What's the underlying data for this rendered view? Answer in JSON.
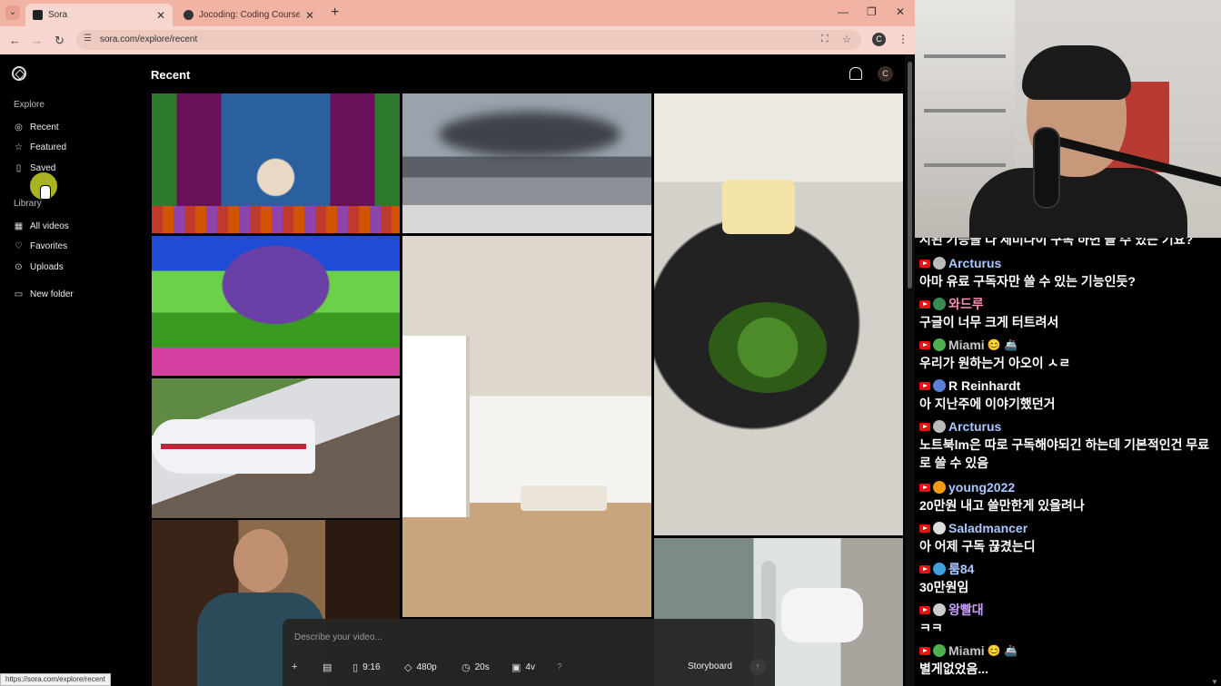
{
  "browser": {
    "tabs": [
      {
        "title": "Sora",
        "active": true
      },
      {
        "title": "Jocoding: Coding Courses & A",
        "active": false
      }
    ],
    "url": "sora.com/explore/recent",
    "profile_initial": "C",
    "status_url": "https://sora.com/explore/recent"
  },
  "sora": {
    "sidebar": {
      "explore_title": "Explore",
      "explore_items": [
        {
          "label": "Recent",
          "icon": "compass-icon",
          "active": true
        },
        {
          "label": "Featured",
          "icon": "star-icon"
        },
        {
          "label": "Saved",
          "icon": "bookmark-icon"
        }
      ],
      "library_title": "Library",
      "library_items": [
        {
          "label": "All videos",
          "icon": "video-grid-icon"
        },
        {
          "label": "Favorites",
          "icon": "heart-icon"
        },
        {
          "label": "Uploads",
          "icon": "upload-icon"
        }
      ],
      "new_folder": "New folder"
    },
    "header": {
      "title": "Recent",
      "avatar_initial": "C"
    },
    "composer": {
      "placeholder": "Describe your video...",
      "aspect": "9:16",
      "resolution": "480p",
      "duration": "20s",
      "variations": "4v",
      "help": "?",
      "storyboard": "Storyboard"
    }
  },
  "chat": {
    "partial_top": "시된 기능을 다 제미나이 구독 하면 쓸 수 있는 기요?",
    "messages": [
      {
        "name": "Arcturus",
        "name_color": "#a9c8ff",
        "avatar_color": "#bbbbbb",
        "text": "아마 유료 구독자만 쓸 수 있는 기능인듯?"
      },
      {
        "name": "와드루",
        "name_color": "#ff8fb0",
        "avatar_color": "#3a8a55",
        "text": "구글이 너무 크게 터트려서"
      },
      {
        "name": "Miami",
        "name_color": "#c7c7c7",
        "avatar_color": "#4caf50",
        "emoji": "😊 🚢",
        "text": "우리가 원하는거 아오이 ㅅㄹ"
      },
      {
        "name": "R Reinhardt",
        "name_color": "#ffffff",
        "avatar_color": "#5b7fd6",
        "text": "아 지난주에 이야기했던거"
      },
      {
        "name": "Arcturus",
        "name_color": "#a9c8ff",
        "avatar_color": "#bbbbbb",
        "text": "노트북lm은 따로 구독해야되긴 하는데 기본적인건 무료로 쓸 수 있음"
      },
      {
        "name": "young2022",
        "name_color": "#a9c8ff",
        "avatar_color": "#f39c12",
        "text": "20만원 내고 쓸만한게 있을려나"
      },
      {
        "name": "Saladmancer",
        "name_color": "#a9c8ff",
        "avatar_color": "#dddddd",
        "text": "아 어제 구독 끊겼는디"
      },
      {
        "name": "룸84",
        "name_color": "#a9c8ff",
        "avatar_color": "#3fa0e0",
        "text": "30만원임"
      },
      {
        "name": "왕빨대",
        "name_color": "#c7a0ff",
        "avatar_color": "#cccccc",
        "text": "ㅋㅋ"
      },
      {
        "name": "Miami",
        "name_color": "#c7c7c7",
        "avatar_color": "#4caf50",
        "emoji": "😊 🚢",
        "text": "별게없었음..."
      }
    ]
  }
}
